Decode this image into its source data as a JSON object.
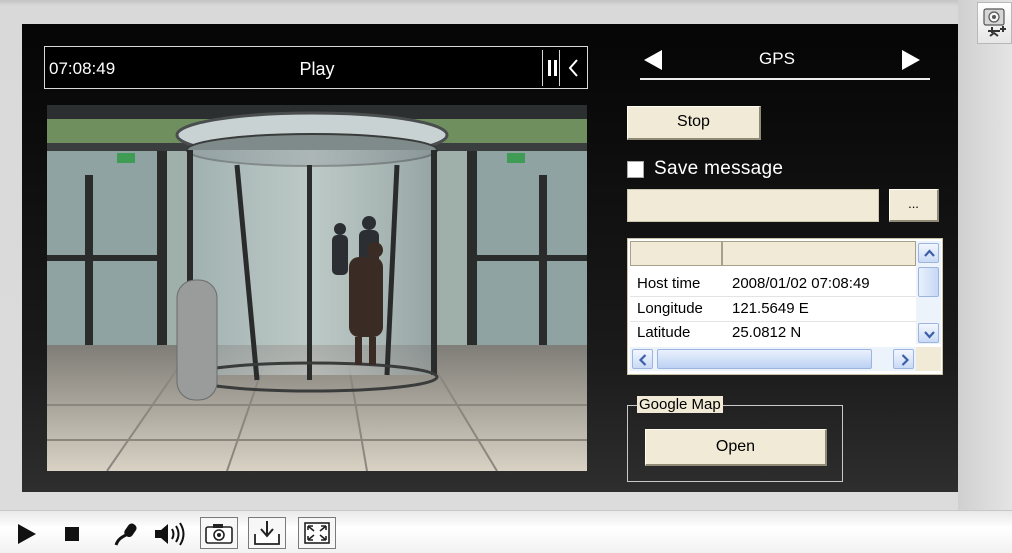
{
  "player": {
    "time": "07:08:49",
    "status": "Play"
  },
  "gps": {
    "title": "GPS",
    "stop_label": "Stop",
    "save_message_label": "Save message",
    "save_message_checked": false,
    "path_value": "",
    "browse_label": "...",
    "table": {
      "columns": [
        "",
        ""
      ],
      "rows": [
        {
          "label": "Host time",
          "value": "2008/01/02 07:08:49"
        },
        {
          "label": "Longitude",
          "value": "121.5649 E"
        },
        {
          "label": "Latitude",
          "value": "25.0812 N"
        }
      ]
    },
    "google_map": {
      "legend": "Google Map",
      "open_label": "Open"
    }
  },
  "toolbar": {
    "items": [
      "play-icon",
      "stop-icon",
      "microphone-icon",
      "speaker-icon",
      "snapshot-camera-icon",
      "save-download-icon",
      "fullscreen-icon"
    ]
  },
  "colors": {
    "panel_background": "#111111",
    "button_beige": "#f0ead6",
    "text_on_dark": "#ffffff"
  }
}
